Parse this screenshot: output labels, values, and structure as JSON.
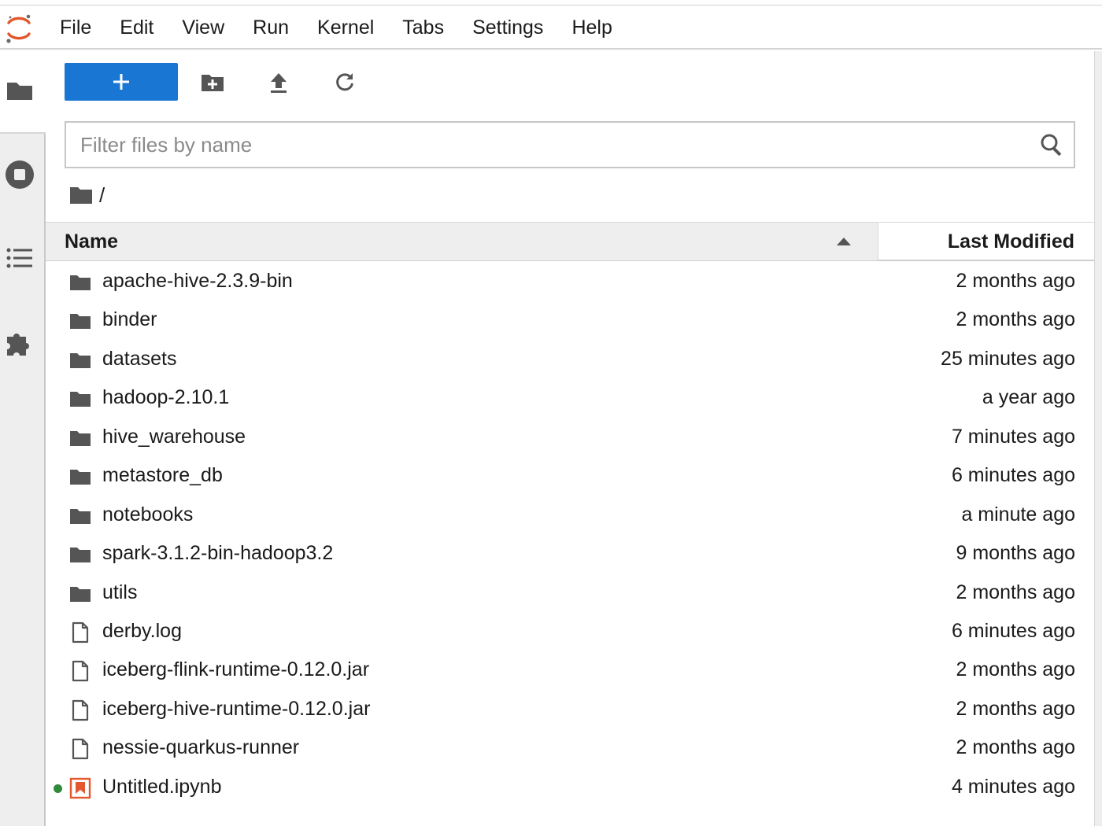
{
  "menu": [
    "File",
    "Edit",
    "View",
    "Run",
    "Kernel",
    "Tabs",
    "Settings",
    "Help"
  ],
  "sidebar": [
    {
      "id": "file-browser",
      "icon": "folder-icon"
    },
    {
      "id": "running-sessions",
      "icon": "stop-circle-icon"
    },
    {
      "id": "table-of-contents",
      "icon": "list-icon"
    },
    {
      "id": "extension-manager",
      "icon": "puzzle-icon"
    }
  ],
  "toolbar": {
    "new_label": "+",
    "new_folder_icon": "new-folder-icon",
    "upload_icon": "upload-icon",
    "refresh_icon": "refresh-icon"
  },
  "filter": {
    "placeholder": "Filter files by name",
    "value": ""
  },
  "breadcrumb": {
    "path": "/"
  },
  "columns": {
    "name": "Name",
    "modified": "Last Modified"
  },
  "files": [
    {
      "name": "apache-hive-2.3.9-bin",
      "modified": "2 months ago",
      "type": "folder"
    },
    {
      "name": "binder",
      "modified": "2 months ago",
      "type": "folder"
    },
    {
      "name": "datasets",
      "modified": "25 minutes ago",
      "type": "folder"
    },
    {
      "name": "hadoop-2.10.1",
      "modified": "a year ago",
      "type": "folder"
    },
    {
      "name": "hive_warehouse",
      "modified": "7 minutes ago",
      "type": "folder"
    },
    {
      "name": "metastore_db",
      "modified": "6 minutes ago",
      "type": "folder"
    },
    {
      "name": "notebooks",
      "modified": "a minute ago",
      "type": "folder"
    },
    {
      "name": "spark-3.1.2-bin-hadoop3.2",
      "modified": "9 months ago",
      "type": "folder"
    },
    {
      "name": "utils",
      "modified": "2 months ago",
      "type": "folder"
    },
    {
      "name": "derby.log",
      "modified": "6 minutes ago",
      "type": "file"
    },
    {
      "name": "iceberg-flink-runtime-0.12.0.jar",
      "modified": "2 months ago",
      "type": "file"
    },
    {
      "name": "iceberg-hive-runtime-0.12.0.jar",
      "modified": "2 months ago",
      "type": "file"
    },
    {
      "name": "nessie-quarkus-runner",
      "modified": "2 months ago",
      "type": "file"
    },
    {
      "name": "Untitled.ipynb",
      "modified": "4 minutes ago",
      "type": "notebook",
      "running": true
    }
  ],
  "colors": {
    "accent": "#1976d2",
    "notebook": "#e4572e",
    "running": "#2e8b3a",
    "icon": "#555555"
  }
}
